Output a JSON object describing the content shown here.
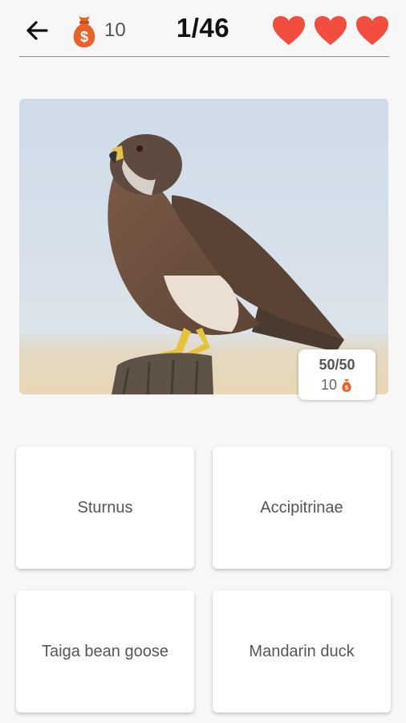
{
  "header": {
    "coins": "10",
    "progress": "1/46",
    "lives": 3
  },
  "icons": {
    "back": "arrow-left-icon",
    "coin": "money-bag-icon",
    "life": "heart-icon"
  },
  "colors": {
    "heart": "#f24e3f",
    "money_bag": "#e8622c",
    "text_primary": "#111111",
    "text_secondary": "#555555"
  },
  "question": {
    "image_subject": "hawk perched on wooden post",
    "score": "50/50",
    "reward": "10"
  },
  "answers": [
    {
      "label": "Sturnus"
    },
    {
      "label": "Accipitrinae"
    },
    {
      "label": "Taiga bean goose"
    },
    {
      "label": "Mandarin duck"
    }
  ]
}
